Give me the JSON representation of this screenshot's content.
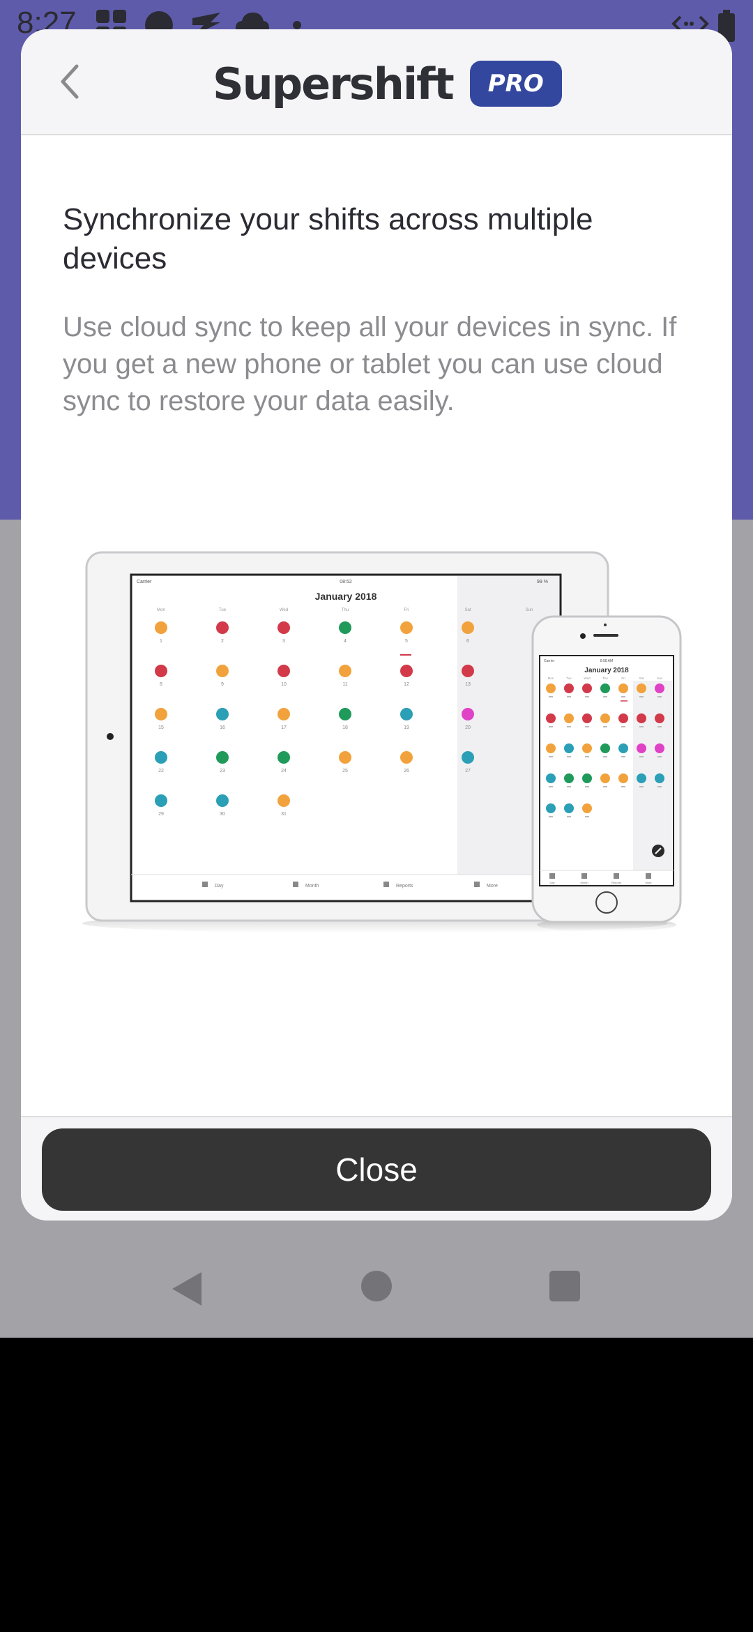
{
  "status_bar": {
    "time": "8:27",
    "icons": [
      "app-grid-icon",
      "circle-icon",
      "send-icon",
      "cloud-icon",
      "dot-icon",
      "code-icon",
      "battery-icon"
    ]
  },
  "dialog": {
    "brand_name": "Supershift",
    "badge": "PRO",
    "back_icon": "chevron-left-icon",
    "title": "Synchronize your shifts across multiple devices",
    "description": "Use cloud sync to keep all your devices in sync. If you get a new phone or tablet you can use cloud sync to restore your data easily.",
    "illustration": {
      "tablet": {
        "status_left": "Carrier",
        "status_center": "08:52",
        "status_right": "99 %",
        "month_title": "January 2018",
        "weekdays": [
          "Mon",
          "Tue",
          "Wed",
          "Thu",
          "Fri",
          "Sat",
          "Sun"
        ],
        "days": [
          "1",
          "2",
          "3",
          "4",
          "5",
          "6",
          "8",
          "9",
          "10",
          "11",
          "12",
          "13",
          "15",
          "16",
          "17",
          "18",
          "19",
          "20",
          "22",
          "23",
          "24",
          "25",
          "26",
          "27",
          "29",
          "30",
          "31"
        ],
        "tabs": [
          "Day",
          "Month",
          "Reports",
          "More"
        ]
      },
      "phone": {
        "status_left": "Carrier",
        "status_center": "8:58 AM",
        "month_title": "January 2018",
        "weekdays": [
          "Mon",
          "Tue",
          "Wed",
          "Thu",
          "Fri",
          "Sat",
          "Sun"
        ],
        "tabs": [
          "Day",
          "Month",
          "Reports",
          "More"
        ]
      }
    },
    "close_label": "Close"
  },
  "colors": {
    "purple": "#5f5bab",
    "orange": "#f2a23c",
    "red": "#d23a4a",
    "green": "#1f9a5a",
    "teal": "#2a9fb6",
    "pink": "#e042c6",
    "button_dark": "#353535",
    "pro_blue": "#34479f"
  }
}
